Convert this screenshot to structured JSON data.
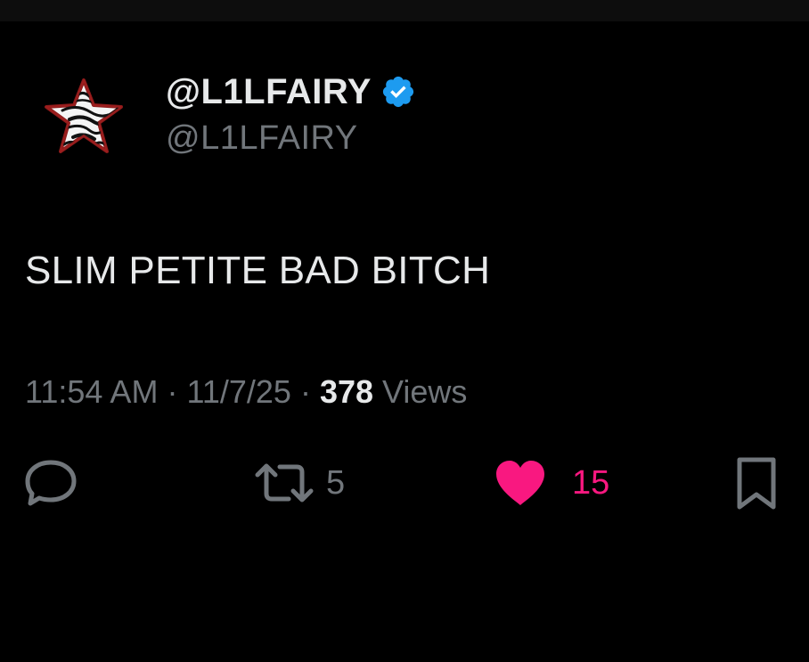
{
  "tweet": {
    "author": {
      "display_name": "@L1LFAIRY",
      "handle": "@L1LFAIRY",
      "verified": true,
      "avatar_icon": "zebra-star-icon"
    },
    "text": "SLIM PETITE BAD BITCH",
    "meta": {
      "time": "11:54 AM",
      "date": "11/7/25",
      "separator": "·",
      "views_count": "378",
      "views_label": "Views"
    },
    "actions": {
      "reply_icon": "reply-icon",
      "retweet_icon": "retweet-icon",
      "retweet_count": "5",
      "like_icon": "heart-icon",
      "like_count": "15",
      "liked": true,
      "bookmark_icon": "bookmark-icon"
    }
  },
  "colors": {
    "background": "#000000",
    "primary_text": "#e7e9ea",
    "secondary_text": "#71767b",
    "verified_blue": "#1d9bf0",
    "like_pink": "#f91880"
  }
}
